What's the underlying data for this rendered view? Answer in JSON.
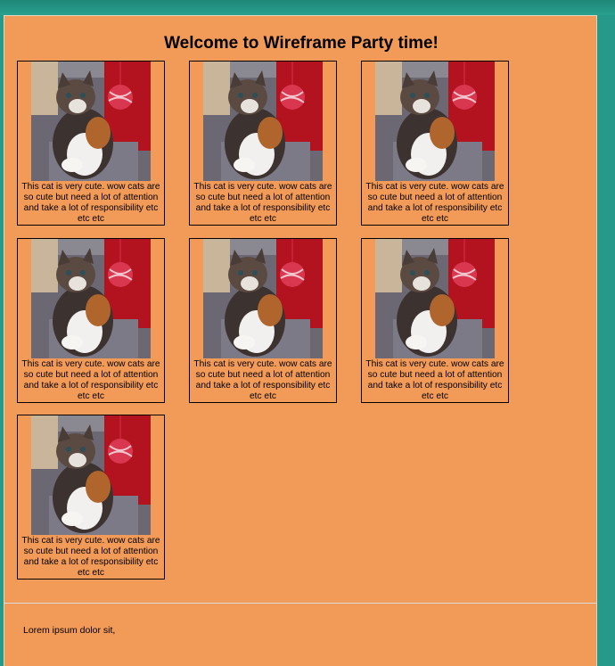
{
  "page": {
    "title": "Welcome to Wireframe Party time!",
    "footer_text": "Lorem ipsum dolor sit,"
  },
  "cards": [
    {
      "image": "kitten-photo",
      "caption": "This cat is very cute. wow cats are so cute but need a lot of attention and take a lot of responsibility etc etc etc"
    },
    {
      "image": "kitten-photo",
      "caption": "This cat is very cute. wow cats are so cute but need a lot of attention and take a lot of responsibility etc etc etc"
    },
    {
      "image": "kitten-photo",
      "caption": "This cat is very cute. wow cats are so cute but need a lot of attention and take a lot of responsibility etc etc etc"
    },
    {
      "image": "kitten-photo",
      "caption": "This cat is very cute. wow cats are so cute but need a lot of attention and take a lot of responsibility etc etc etc"
    },
    {
      "image": "kitten-photo",
      "caption": "This cat is very cute. wow cats are so cute but need a lot of attention and take a lot of responsibility etc etc etc"
    },
    {
      "image": "kitten-photo",
      "caption": "This cat is very cute. wow cats are so cute but need a lot of attention and take a lot of responsibility etc etc etc"
    },
    {
      "image": "kitten-photo",
      "caption": "This cat is very cute. wow cats are so cute but need a lot of attention and take a lot of responsibility etc etc etc"
    }
  ],
  "colors": {
    "page_background": "#f29a58",
    "outer_background": "#26998a",
    "card_border": "#000000"
  }
}
